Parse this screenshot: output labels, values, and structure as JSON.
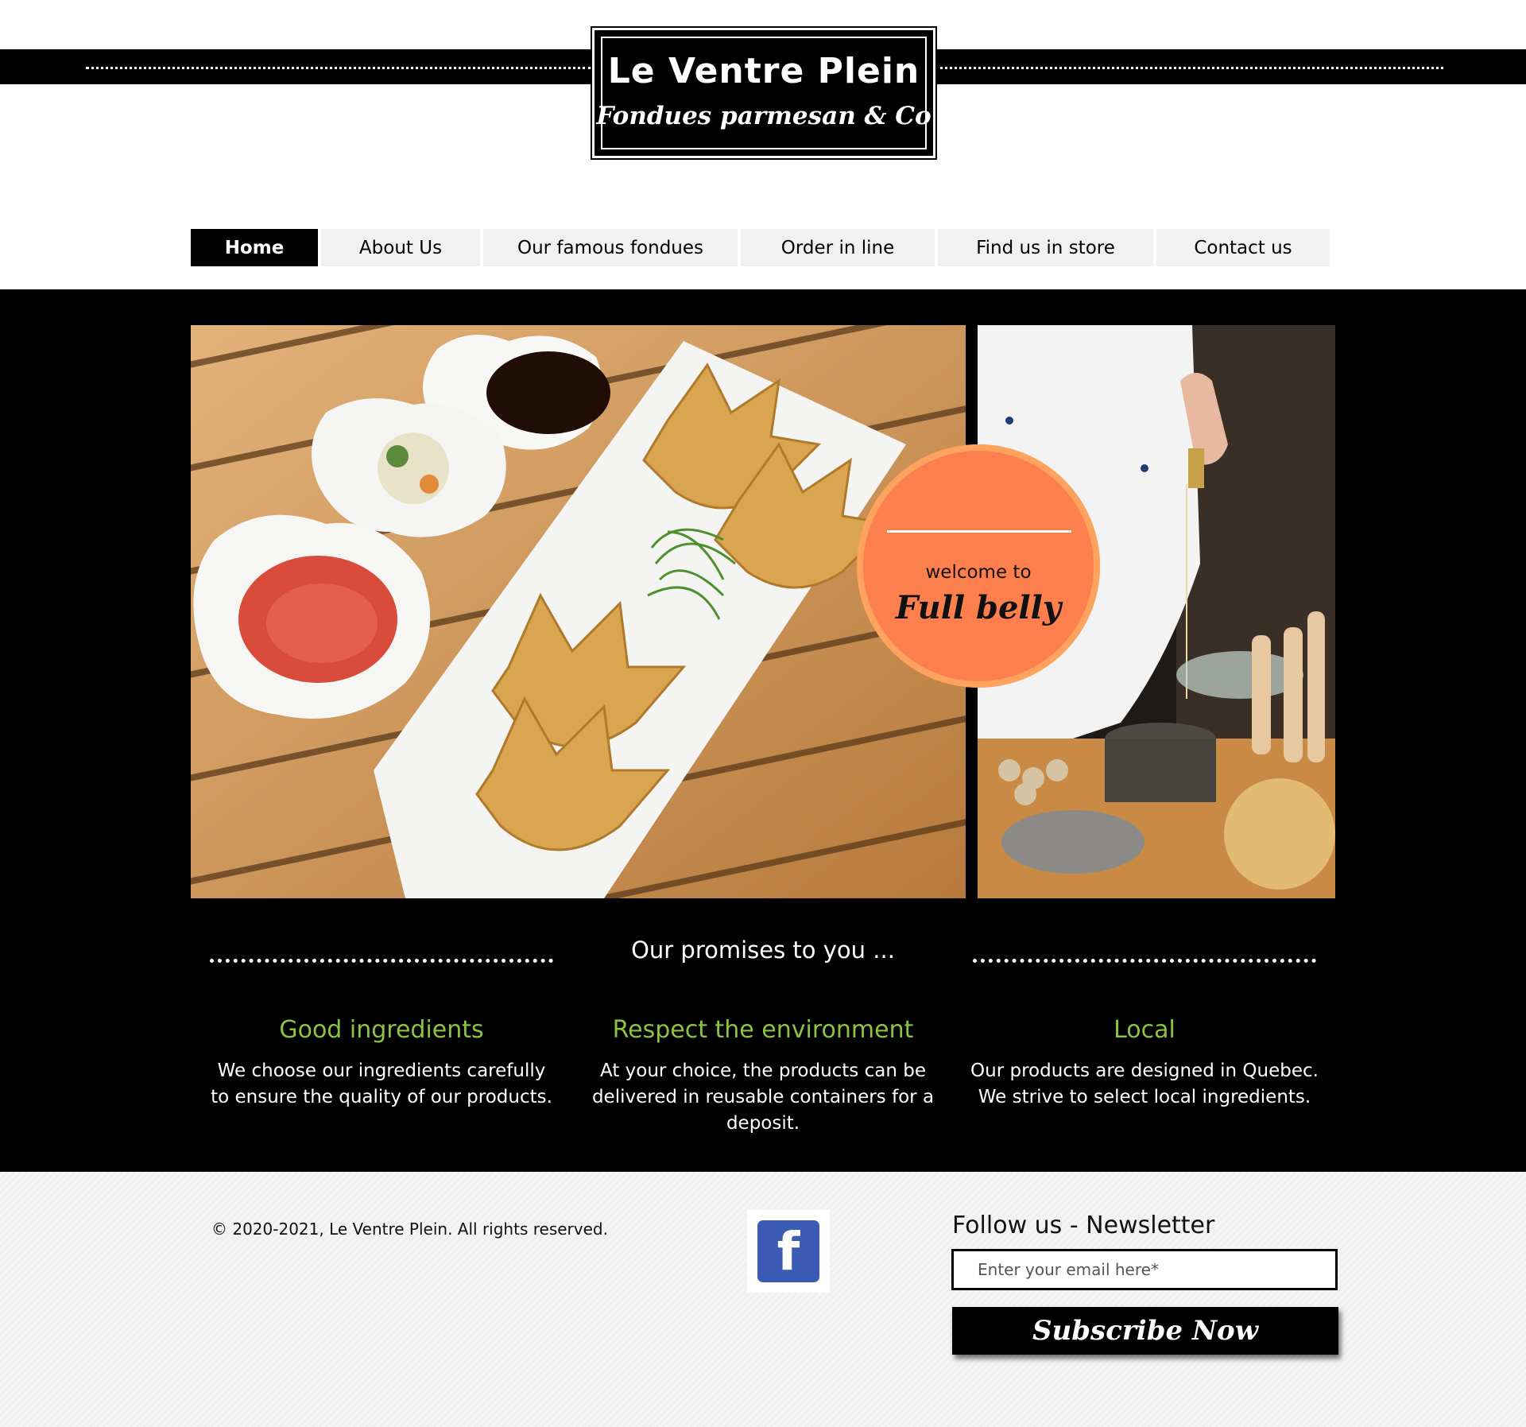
{
  "brand": {
    "title": "Le Ventre Plein",
    "subtitle": "Fondues parmesan & Co"
  },
  "nav": {
    "items": [
      {
        "label": "Home",
        "active": true
      },
      {
        "label": "About Us",
        "active": false
      },
      {
        "label": "Our famous fondues",
        "active": false
      },
      {
        "label": "Order in line",
        "active": false
      },
      {
        "label": "Find us in store",
        "active": false
      },
      {
        "label": "Contact us",
        "active": false
      }
    ]
  },
  "hero": {
    "welcome_to": "welcome to",
    "welcome_name": "Full belly",
    "circle_color": "#fd7f4e"
  },
  "promises": {
    "title": "Our promises to you ...",
    "accent_color": "#8cc43f",
    "items": [
      {
        "heading": "Good ingredients",
        "text": "We choose our ingredients carefully to ensure the quality of our products."
      },
      {
        "heading": "Respect the environment",
        "text": "At your choice, the products can be delivered in reusable containers for a deposit."
      },
      {
        "heading": "Local",
        "text": "Our products are designed in Quebec. We strive to select local ingredients."
      }
    ]
  },
  "footer": {
    "copyright": "© 2020-2021, Le Ventre Plein. All rights reserved.",
    "social_icon": "facebook-icon",
    "facebook_color": "#3b5bb5",
    "follow_title": "Follow us - Newsletter",
    "email_placeholder": "Enter your email here*",
    "email_value": "",
    "subscribe_label": "Subscribe Now"
  }
}
